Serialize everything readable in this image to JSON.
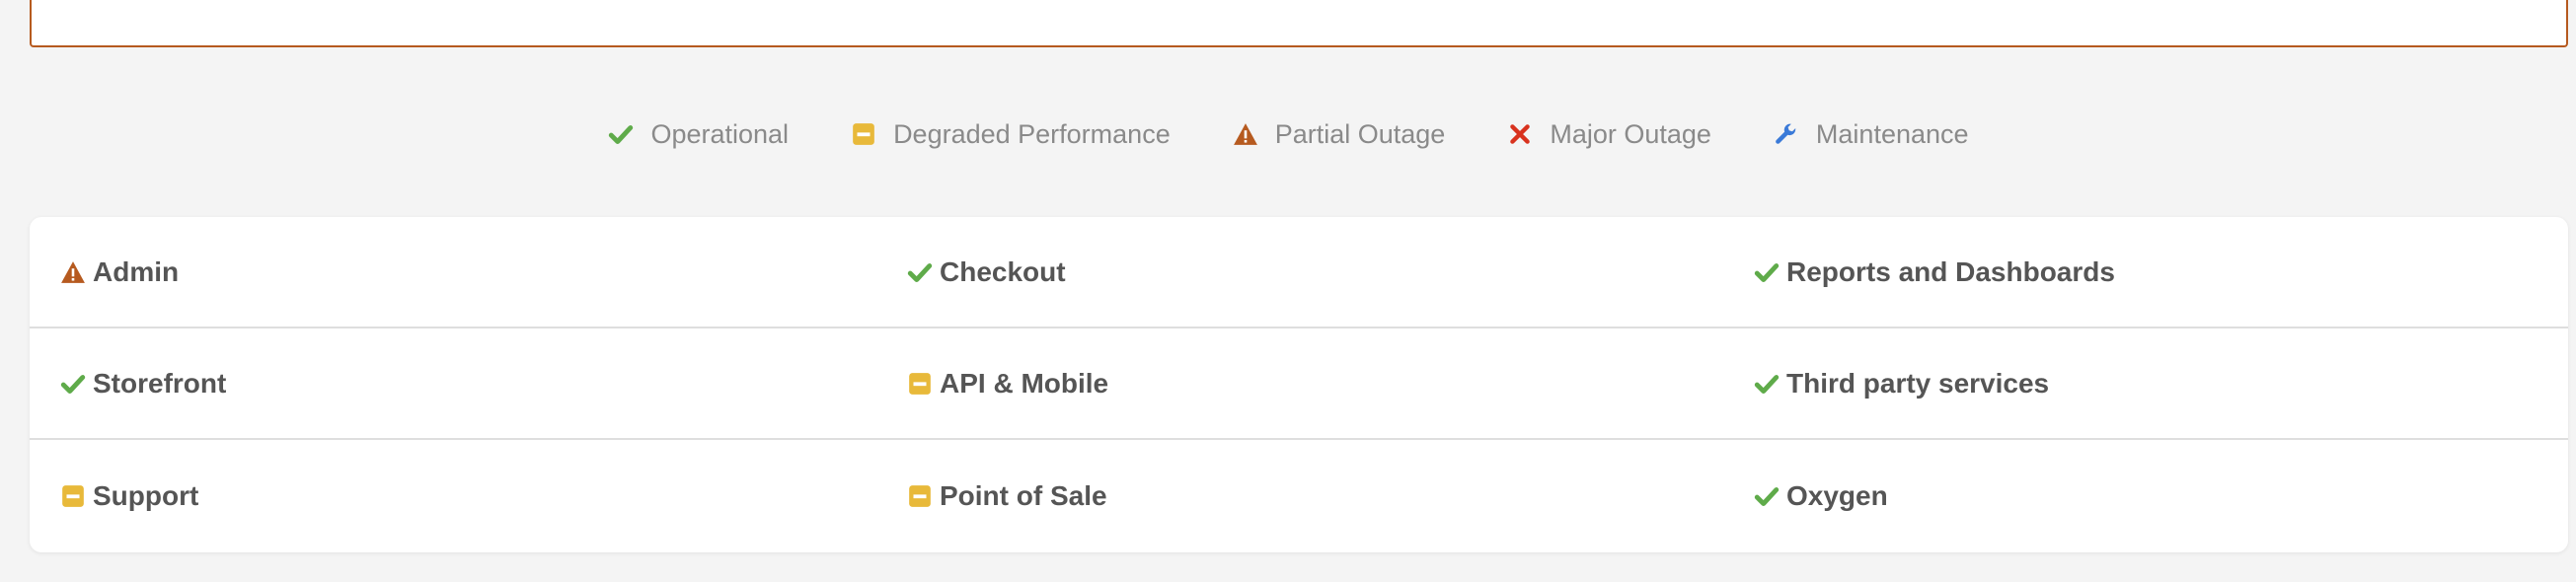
{
  "legend": [
    {
      "label": "Operational",
      "icon": "check-icon",
      "color": "#5fab4a"
    },
    {
      "label": "Degraded Performance",
      "icon": "minus-square-icon",
      "color": "#e8b93a"
    },
    {
      "label": "Partial Outage",
      "icon": "warning-icon",
      "color": "#b65a1f"
    },
    {
      "label": "Major Outage",
      "icon": "x-icon",
      "color": "#d8321e"
    },
    {
      "label": "Maintenance",
      "icon": "wrench-icon",
      "color": "#3a7ad8"
    }
  ],
  "components": [
    [
      {
        "label": "Admin",
        "status": "partial-outage"
      },
      {
        "label": "Checkout",
        "status": "operational"
      },
      {
        "label": "Reports and Dashboards",
        "status": "operational"
      }
    ],
    [
      {
        "label": "Storefront",
        "status": "operational"
      },
      {
        "label": "API & Mobile",
        "status": "degraded"
      },
      {
        "label": "Third party services",
        "status": "operational"
      }
    ],
    [
      {
        "label": "Support",
        "status": "degraded"
      },
      {
        "label": "Point of Sale",
        "status": "degraded"
      },
      {
        "label": "Oxygen",
        "status": "operational"
      }
    ]
  ]
}
